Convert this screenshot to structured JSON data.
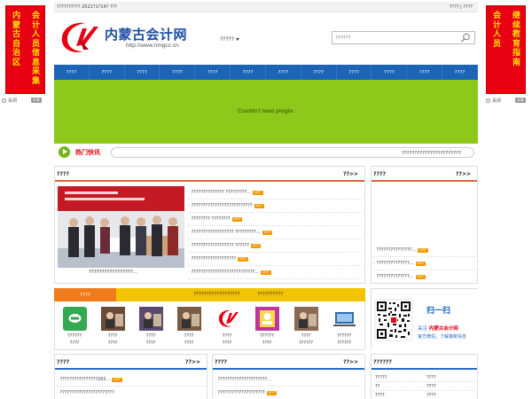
{
  "side_banner_left": {
    "columns": [
      [
        "会",
        "计",
        "人",
        "员",
        "信",
        "息",
        "采",
        "集"
      ],
      [
        "内",
        "蒙",
        "古",
        "自",
        "治",
        "区"
      ]
    ],
    "close_label": "关闭",
    "share_label": "分享"
  },
  "side_banner_right": {
    "columns": [
      [
        "继",
        "续",
        "教",
        "育",
        "指",
        "南"
      ],
      [
        "会",
        "计",
        "人",
        "员"
      ]
    ],
    "close_label": "关闭",
    "share_label": "分享"
  },
  "topbar": {
    "left_text": "?????????? 2021?1?14? ???",
    "right_text": "???? | ????"
  },
  "header": {
    "logo_title": "内蒙古会计网",
    "logo_url": "http://www.nmgcc.cn",
    "city_select": "?????",
    "search_placeholder": "??????"
  },
  "nav": [
    "????",
    "????",
    "????",
    "????",
    "????",
    "????",
    "????",
    "????",
    "????",
    "????",
    "????",
    "????"
  ],
  "plugin": {
    "message": "Couldn't load plugin."
  },
  "ticker": {
    "label": "热门快讯",
    "text": "???????????????????????"
  },
  "panel_main": {
    "title": "????",
    "more": "??>>",
    "photo_caption": "?????????????????...",
    "items": [
      {
        "text": "?????????????? ?????????...",
        "hot": true
      },
      {
        "text": "??????????????????????????",
        "hot": true
      },
      {
        "text": "???????? ????????",
        "hot": true
      },
      {
        "text": "?????????????????? ?????????...",
        "hot": true
      },
      {
        "text": "?????????????????? ??????",
        "hot": true
      },
      {
        "text": "???????????????????",
        "hot": true
      },
      {
        "text": "???????????????????????????...",
        "hot": true
      }
    ]
  },
  "panel_side": {
    "title": "????",
    "more": "??>>",
    "items": [
      {
        "text": "???????????????...",
        "hot": true
      },
      {
        "text": "??????????????...",
        "hot": true
      },
      {
        "text": "??????????????...",
        "hot": true
      }
    ]
  },
  "tabs": {
    "active": "????",
    "tab2": "??????????????????",
    "tab3": "??????????"
  },
  "apps": [
    {
      "label": "??????",
      "sub": "????",
      "icon": "pas-icon",
      "color": "#34a853"
    },
    {
      "label": "????",
      "sub": "????",
      "icon": "photo-icon",
      "color": "#6b4a3a"
    },
    {
      "label": "????",
      "sub": "????",
      "icon": "photo-icon",
      "color": "#5a4a6e"
    },
    {
      "label": "????",
      "sub": "????",
      "icon": "photo-icon",
      "color": "#7a5b44"
    },
    {
      "label": "????",
      "sub": "????",
      "icon": "logo-icon",
      "color": "#e60012"
    },
    {
      "label": "??????",
      "sub": "????",
      "icon": "profile-icon",
      "color": "#c0359c"
    },
    {
      "label": "????",
      "sub": "??????",
      "icon": "photo-icon",
      "color": "#8a6a55"
    },
    {
      "label": "??????",
      "sub": "??????",
      "icon": "laptop-icon",
      "color": "#2b6cb0"
    }
  ],
  "qr": {
    "scan_label": "扫一扫",
    "follow_prefix": "关注",
    "follow_name": "内蒙古会计网",
    "follow_line2": "官方微信，了解最新信息"
  },
  "panel_bottom_left": {
    "title": "????",
    "more": "??>>",
    "items": [
      {
        "text": "????????????????202...",
        "hot": true
      },
      {
        "text": "???????????????????????",
        "hot": false
      }
    ]
  },
  "panel_bottom_mid": {
    "title": "????",
    "more": "??>>",
    "items": [
      {
        "text": "?????????????????????...",
        "hot": false
      },
      {
        "text": "????????????????????",
        "hot": true
      }
    ]
  },
  "panel_bottom_right": {
    "title": "??????",
    "rows": [
      [
        "?????",
        "????"
      ],
      [
        "??",
        "????"
      ],
      [
        "????",
        "????"
      ]
    ]
  }
}
